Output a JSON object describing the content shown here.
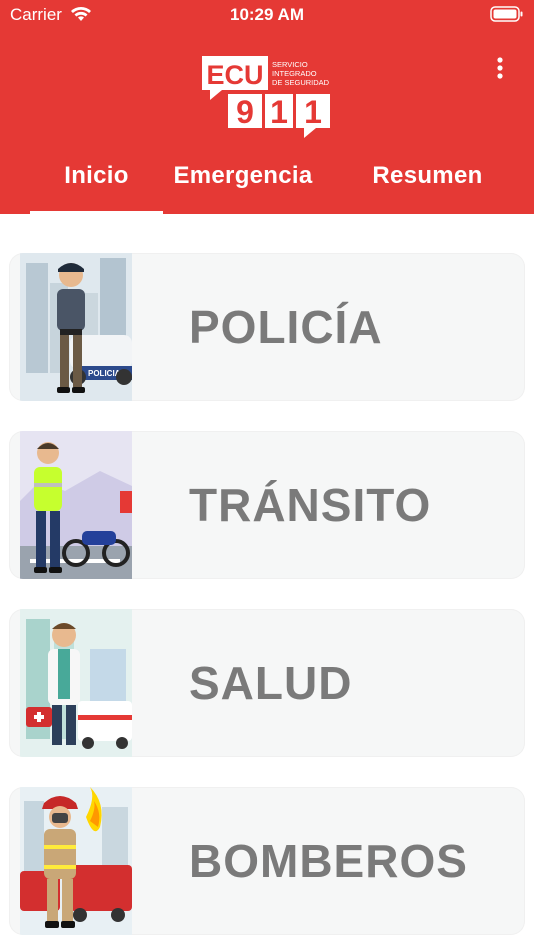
{
  "status": {
    "carrier": "Carrier",
    "time": "10:29 AM"
  },
  "logo": {
    "ecu": "ECU",
    "digits": [
      "9",
      "1",
      "1"
    ],
    "tagline_1": "SERVICIO",
    "tagline_2": "INTEGRADO",
    "tagline_3": "DE SEGURIDAD"
  },
  "tabs": [
    {
      "label": "Inicio",
      "active": true
    },
    {
      "label": "Emergencia",
      "active": false
    },
    {
      "label": "Resumen",
      "active": false
    }
  ],
  "cards": [
    {
      "label": "POLICÍA",
      "image_text": "POLICIA"
    },
    {
      "label": "TRÁNSITO"
    },
    {
      "label": "SALUD"
    },
    {
      "label": "BOMBEROS"
    }
  ],
  "colors": {
    "brand_red": "#e53935",
    "card_bg": "#f6f7f7",
    "card_text": "#7a7a7a"
  }
}
